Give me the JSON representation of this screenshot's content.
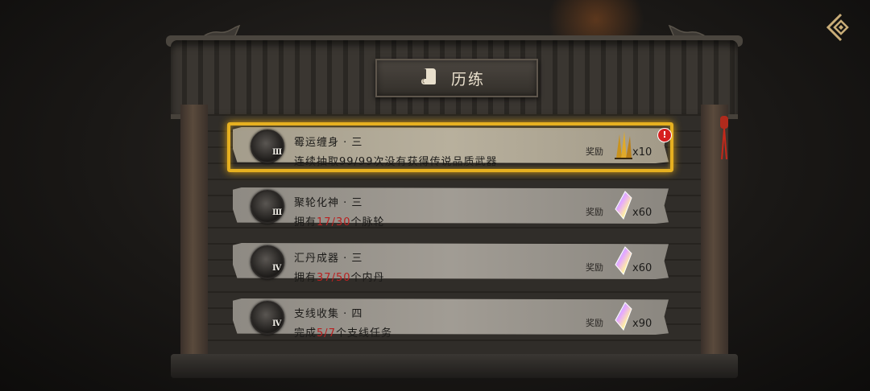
{
  "panel": {
    "title": "历练"
  },
  "tasks": [
    {
      "name": "霉运缠身 · 三",
      "rank": "Ⅲ",
      "desc_pre": "连续抽取99/99次没有获得传说品质武器",
      "progress": "",
      "total": "",
      "desc_post": "",
      "reward_label": "奖励",
      "reward_count": "x10",
      "reward_icon": "weapon-shards-icon",
      "completed": true
    },
    {
      "name": "聚轮化神 · 三",
      "rank": "Ⅲ",
      "desc_pre": "拥有",
      "progress": "17",
      "total": "30",
      "desc_post": "个脉轮",
      "reward_label": "奖励",
      "reward_count": "x60",
      "reward_icon": "crystal-icon",
      "completed": false
    },
    {
      "name": "汇丹成器 · 三",
      "rank": "Ⅳ",
      "desc_pre": "拥有",
      "progress": "37",
      "total": "50",
      "desc_post": "个内丹",
      "reward_label": "奖励",
      "reward_count": "x60",
      "reward_icon": "crystal-icon",
      "completed": false
    },
    {
      "name": "支线收集 · 四",
      "rank": "Ⅳ",
      "desc_pre": "完成",
      "progress": "5",
      "total": "7",
      "desc_post": "个支线任务",
      "reward_label": "奖励",
      "reward_count": "x90",
      "reward_icon": "crystal-icon",
      "completed": false
    }
  ],
  "alert": {
    "text": "!"
  },
  "colors": {
    "highlight": "#e6b020",
    "progress_red": "#b92020",
    "alert": "#d62020"
  }
}
